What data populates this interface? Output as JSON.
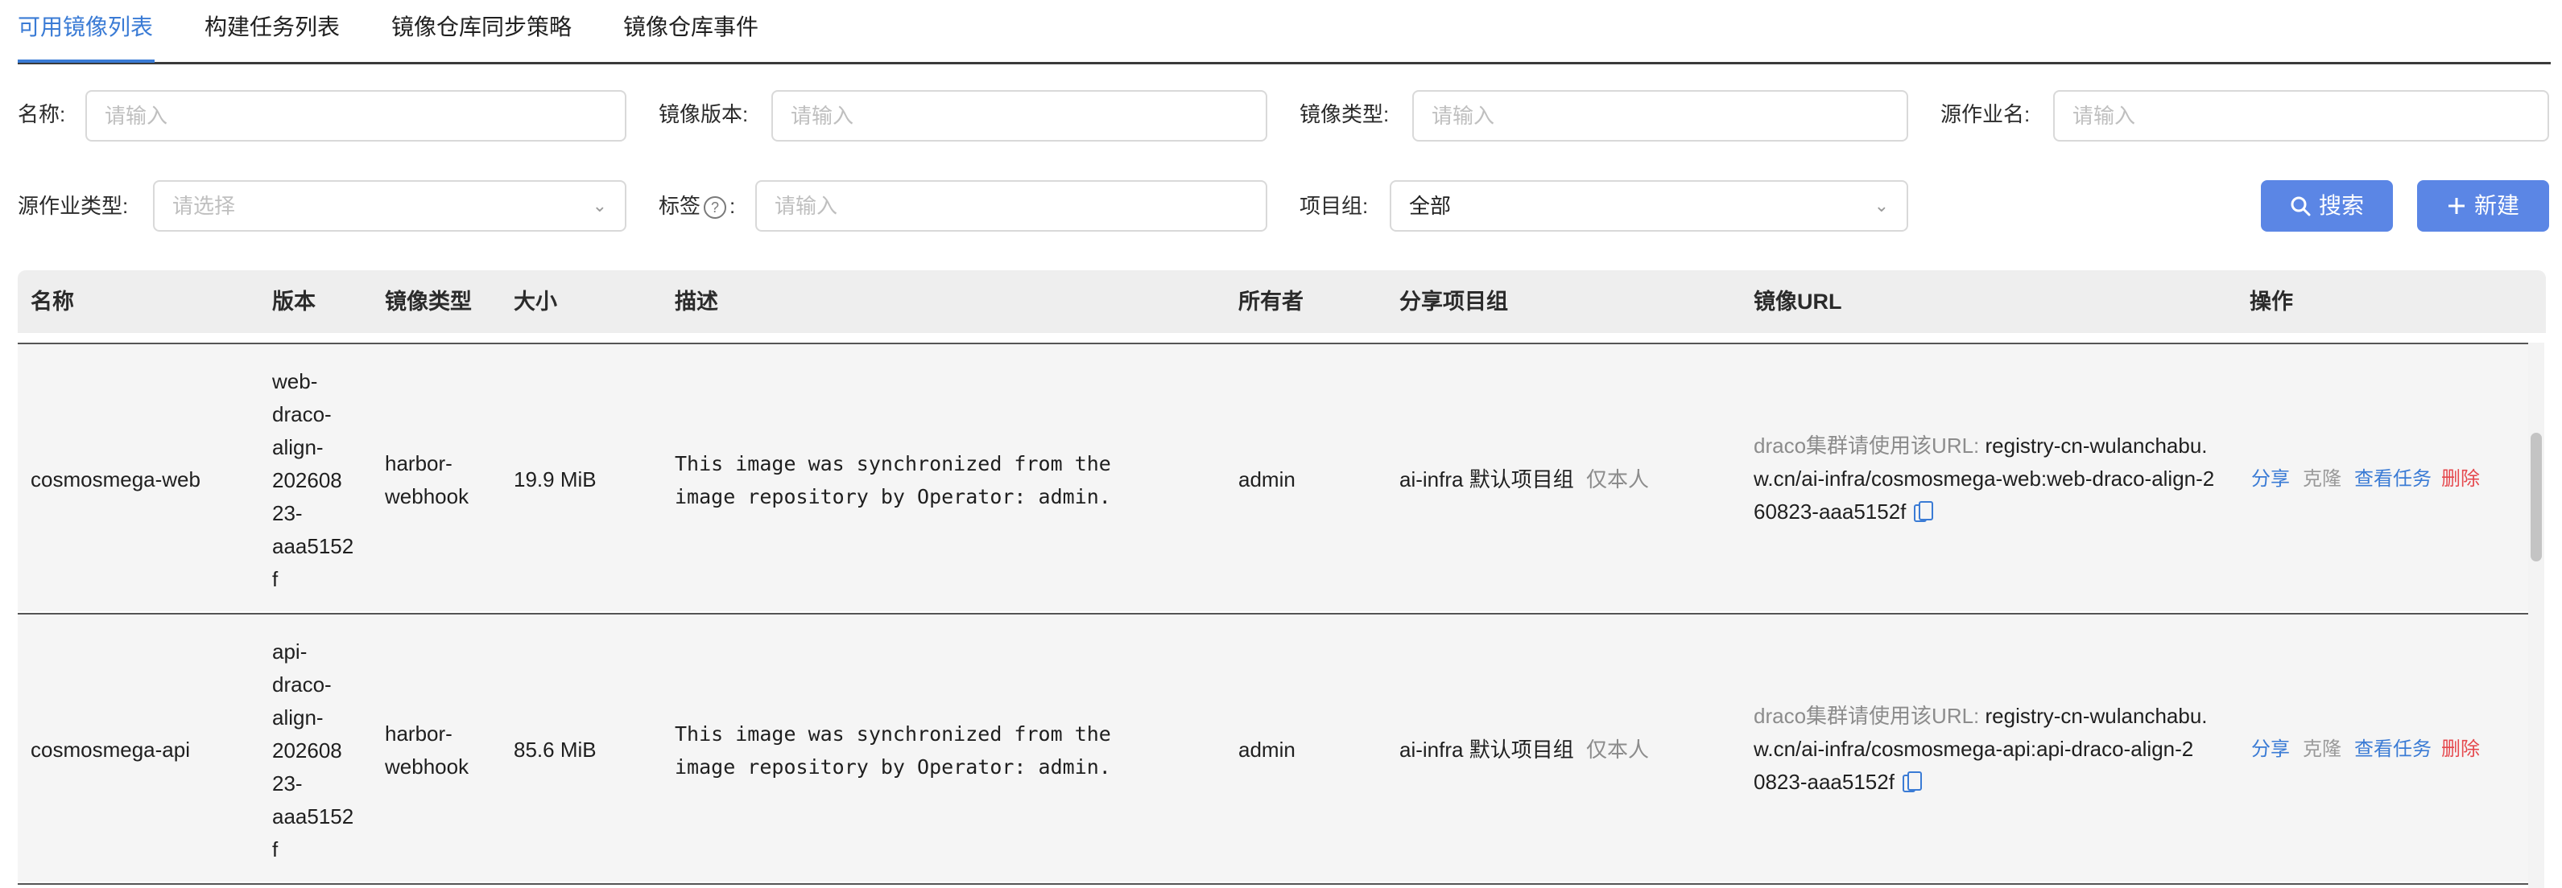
{
  "tabs": [
    {
      "label": "可用镜像列表",
      "active": true
    },
    {
      "label": "构建任务列表",
      "active": false
    },
    {
      "label": "镜像仓库同步策略",
      "active": false
    },
    {
      "label": "镜像仓库事件",
      "active": false
    }
  ],
  "filters": {
    "name": {
      "label": "名称:",
      "placeholder": "请输入"
    },
    "version": {
      "label": "镜像版本:",
      "placeholder": "请输入"
    },
    "type": {
      "label": "镜像类型:",
      "placeholder": "请输入"
    },
    "source_job": {
      "label": "源作业名:",
      "placeholder": "请输入"
    },
    "source_job_type": {
      "label": "源作业类型:",
      "placeholder": "请选择"
    },
    "tags": {
      "label_pre": "标签",
      "label_post": ":",
      "help_glyph": "?",
      "placeholder": "请输入"
    },
    "project": {
      "label": "项目组:",
      "value": "全部"
    }
  },
  "buttons": {
    "search": "搜索",
    "create": "新建"
  },
  "icons": {
    "search": "search-icon",
    "plus": "plus-icon",
    "chevron": "chevron-down-icon",
    "copy": "copy-icon",
    "help": "question-circle-icon"
  },
  "colors": {
    "accent": "#3a7bd5",
    "button": "#5b86e5",
    "danger": "#e5484d"
  },
  "table": {
    "columns": [
      "名称",
      "版本",
      "镜像类型",
      "大小",
      "描述",
      "所有者",
      "分享项目组",
      "镜像URL",
      "操作"
    ],
    "rows": [
      {
        "name": "cosmosmega-web",
        "version_lines": [
          "web-",
          "draco-",
          "align-",
          "202608",
          "23-",
          "aaa5152",
          "f"
        ],
        "type_lines": [
          "harbor-",
          "webhook"
        ],
        "size": "19.9 MiB",
        "desc_lines": [
          "This image was synchronized from the",
          "image repository by Operator: admin."
        ],
        "owner": "admin",
        "share_group": "ai-infra 默认项目组",
        "share_scope": "仅本人",
        "url_prefix": "draco集群请使用该URL:",
        "url_lines": [
          " registry-cn-wulanchabu.",
          "w.cn/ai-infra/cosmosmega-web:web-draco-align-2",
          "60823-aaa5152f"
        ],
        "actions": {
          "share": "分享",
          "clone": "克隆",
          "view_tasks": "查看任务",
          "delete": "删除"
        }
      },
      {
        "name": "cosmosmega-api",
        "version_lines": [
          "api-",
          "draco-",
          "align-",
          "202608",
          "23-",
          "aaa5152",
          "f"
        ],
        "type_lines": [
          "harbor-",
          "webhook"
        ],
        "size": "85.6 MiB",
        "desc_lines": [
          "This image was synchronized from the",
          "image repository by Operator: admin."
        ],
        "owner": "admin",
        "share_group": "ai-infra 默认项目组",
        "share_scope": "仅本人",
        "url_prefix": "draco集群请使用该URL:",
        "url_lines": [
          " registry-cn-wulanchabu.",
          "w.cn/ai-infra/cosmosmega-api:api-draco-align-2",
          "0823-aaa5152f"
        ],
        "actions": {
          "share": "分享",
          "clone": "克隆",
          "view_tasks": "查看任务",
          "delete": "删除"
        }
      }
    ]
  }
}
